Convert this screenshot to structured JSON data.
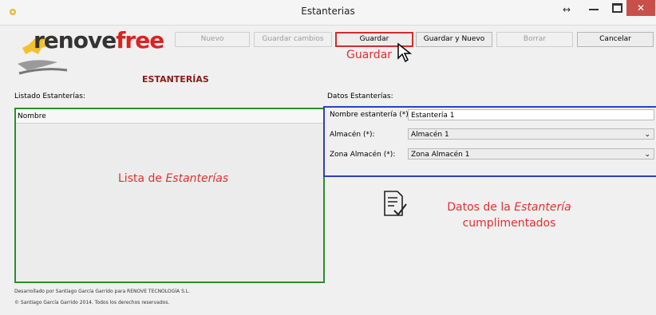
{
  "window": {
    "title": "Estanterias",
    "move_glyph": "↔",
    "close_glyph": "✕"
  },
  "header": {
    "logo_part1": "renove",
    "logo_part2": "free",
    "section_title": "ESTANTERÍAS"
  },
  "toolbar": {
    "nuevo": "Nuevo",
    "guardar_cambios": "Guardar cambios",
    "guardar": "Guardar",
    "guardar_y_nuevo": "Guardar y Nuevo",
    "borrar": "Borrar",
    "cancelar": "Cancelar"
  },
  "annotations": {
    "guardar": "Guardar",
    "lista_prefix": "Lista de ",
    "lista_em": "Estanterías",
    "datos_line1_prefix": "Datos de la ",
    "datos_line1_em": "Estantería",
    "datos_line2": "cumplimentados"
  },
  "list": {
    "label": "Listado Estanterías:",
    "column": "Nombre"
  },
  "form": {
    "label": "Datos Estanterías:",
    "nombre_label": "Nombre estantería (*):",
    "nombre_value": "Estantería 1",
    "almacen_label": "Almacén (*):",
    "almacen_value": "Almacén 1",
    "zona_label": "Zona Almacén (*):",
    "zona_value": "Zona Almacén 1"
  },
  "footer": {
    "line1": "Desarrollado por Santiago García Garrido para RENOVE TECNOLOGÍA S.L.",
    "line2": "© Santiago García Garrido 2014. Todos los derechos reservados."
  },
  "colors": {
    "accent_red": "#e03030",
    "list_border": "#2e8b2e",
    "data_border": "#2a3fc9"
  }
}
